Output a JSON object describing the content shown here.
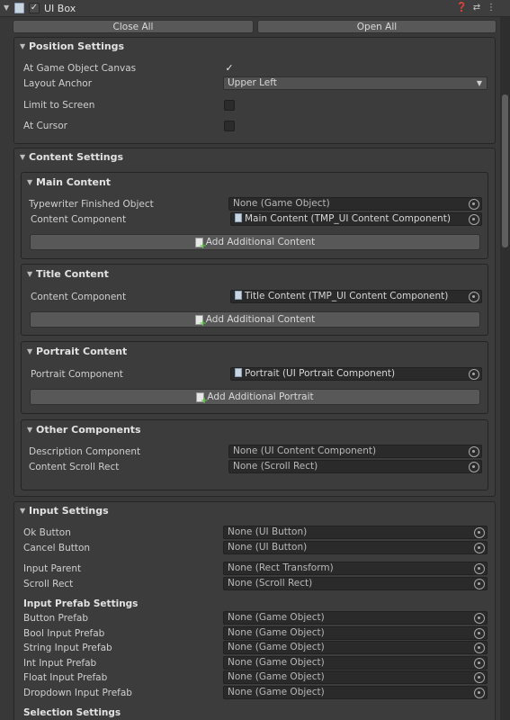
{
  "header": {
    "title": "UI Box",
    "enabled": true
  },
  "toolbar": {
    "close_all": "Close All",
    "open_all": "Open All"
  },
  "position_settings": {
    "title": "Position Settings",
    "at_game_object_canvas": "At Game Object Canvas",
    "at_game_object_canvas_checked": true,
    "layout_anchor": "Layout Anchor",
    "layout_anchor_value": "Upper Left",
    "limit_to_screen": "Limit to Screen",
    "at_cursor": "At Cursor"
  },
  "content_settings": {
    "title": "Content Settings",
    "main_content": {
      "title": "Main Content",
      "typewriter_label": "Typewriter Finished Object",
      "typewriter_value": "None (Game Object)",
      "component_label": "Content Component",
      "component_value": "Main Content (TMP_UI Content Component)",
      "add_button": "Add Additional Content"
    },
    "title_content": {
      "title": "Title Content",
      "component_label": "Content Component",
      "component_value": "Title Content (TMP_UI Content Component)",
      "add_button": "Add Additional Content"
    },
    "portrait_content": {
      "title": "Portrait Content",
      "component_label": "Portrait Component",
      "component_value": "Portrait (UI Portrait Component)",
      "add_button": "Add Additional Portrait"
    },
    "other_components": {
      "title": "Other Components",
      "description_label": "Description Component",
      "description_value": "None (UI Content Component)",
      "scroll_label": "Content Scroll Rect",
      "scroll_value": "None (Scroll Rect)"
    }
  },
  "input_settings": {
    "title": "Input Settings",
    "ok_button": {
      "label": "Ok Button",
      "value": "None (UI Button)"
    },
    "cancel_button": {
      "label": "Cancel Button",
      "value": "None (UI Button)"
    },
    "input_parent": {
      "label": "Input Parent",
      "value": "None (Rect Transform)"
    },
    "scroll_rect": {
      "label": "Scroll Rect",
      "value": "None (Scroll Rect)"
    },
    "prefab_settings_title": "Input Prefab Settings",
    "button_prefab": {
      "label": "Button Prefab",
      "value": "None (Game Object)"
    },
    "bool_input_prefab": {
      "label": "Bool Input Prefab",
      "value": "None (Game Object)"
    },
    "string_input_prefab": {
      "label": "String Input Prefab",
      "value": "None (Game Object)"
    },
    "int_input_prefab": {
      "label": "Int Input Prefab",
      "value": "None (Game Object)"
    },
    "float_input_prefab": {
      "label": "Float Input Prefab",
      "value": "None (Game Object)"
    },
    "dropdown_input_prefab": {
      "label": "Dropdown Input Prefab",
      "value": "None (Game Object)"
    },
    "selection_settings_title": "Selection Settings"
  }
}
